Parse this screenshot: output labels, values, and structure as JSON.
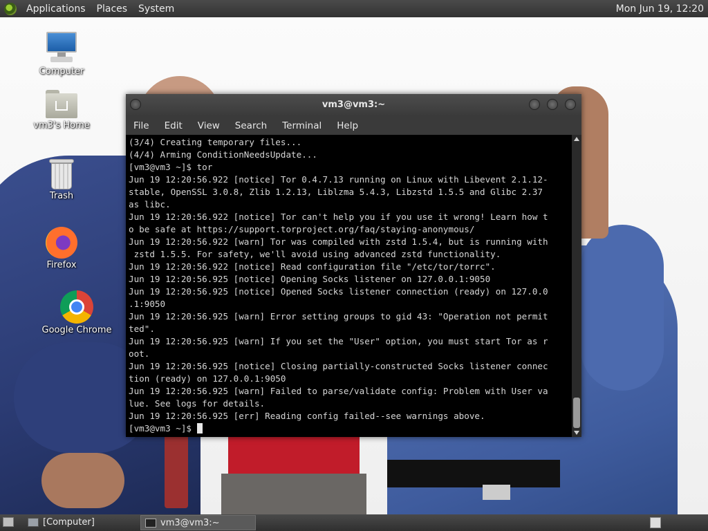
{
  "top_panel": {
    "menus": [
      "Applications",
      "Places",
      "System"
    ],
    "clock": "Mon Jun 19, 12:20"
  },
  "desktop_icons": [
    {
      "label": "Computer",
      "icon": "computer-icon"
    },
    {
      "label": "vm3's Home",
      "icon": "home-folder-icon"
    },
    {
      "label": "Trash",
      "icon": "trash-icon"
    },
    {
      "label": "Firefox",
      "icon": "firefox-icon"
    },
    {
      "label": "Google Chrome",
      "icon": "chrome-icon"
    }
  ],
  "terminal_window": {
    "title": "vm3@vm3:~",
    "menu": [
      "File",
      "Edit",
      "View",
      "Search",
      "Terminal",
      "Help"
    ],
    "lines": [
      "(3/4) Creating temporary files...",
      "(4/4) Arming ConditionNeedsUpdate...",
      "[vm3@vm3 ~]$ tor",
      "Jun 19 12:20:56.922 [notice] Tor 0.4.7.13 running on Linux with Libevent 2.1.12-",
      "stable, OpenSSL 3.0.8, Zlib 1.2.13, Liblzma 5.4.3, Libzstd 1.5.5 and Glibc 2.37",
      "as libc.",
      "Jun 19 12:20:56.922 [notice] Tor can't help you if you use it wrong! Learn how t",
      "o be safe at https://support.torproject.org/faq/staying-anonymous/",
      "Jun 19 12:20:56.922 [warn] Tor was compiled with zstd 1.5.4, but is running with",
      " zstd 1.5.5. For safety, we'll avoid using advanced zstd functionality.",
      "Jun 19 12:20:56.922 [notice] Read configuration file \"/etc/tor/torrc\".",
      "Jun 19 12:20:56.925 [notice] Opening Socks listener on 127.0.0.1:9050",
      "Jun 19 12:20:56.925 [notice] Opened Socks listener connection (ready) on 127.0.0",
      ".1:9050",
      "Jun 19 12:20:56.925 [warn] Error setting groups to gid 43: \"Operation not permit",
      "ted\".",
      "Jun 19 12:20:56.925 [warn] If you set the \"User\" option, you must start Tor as r",
      "oot.",
      "Jun 19 12:20:56.925 [notice] Closing partially-constructed Socks listener connec",
      "tion (ready) on 127.0.0.1:9050",
      "Jun 19 12:20:56.925 [warn] Failed to parse/validate config: Problem with User va",
      "lue. See logs for details.",
      "Jun 19 12:20:56.925 [err] Reading config failed--see warnings above."
    ],
    "prompt": "[vm3@vm3 ~]$ "
  },
  "taskbar": {
    "tasks": [
      {
        "label": "[Computer]",
        "icon": "computer-small-icon",
        "active": false
      },
      {
        "label": "vm3@vm3:~",
        "icon": "terminal-small-icon",
        "active": true
      }
    ]
  }
}
